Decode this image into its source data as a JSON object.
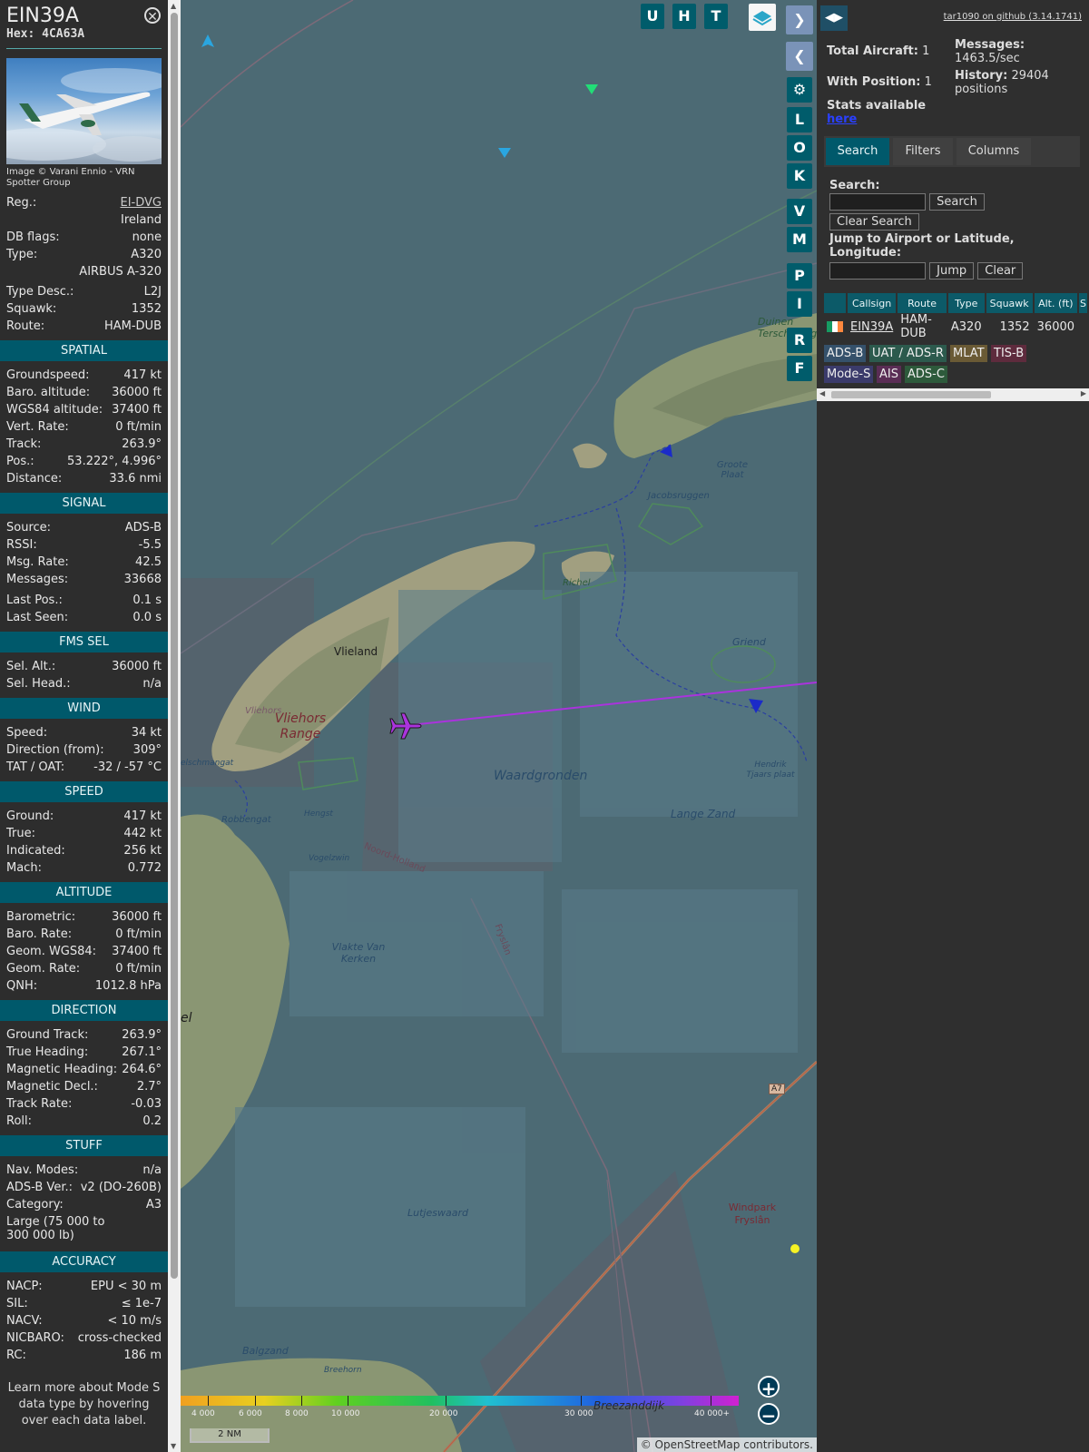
{
  "info": {
    "callsign": "EIN39A",
    "hex_label": "Hex:",
    "hex": "4CA63A",
    "photo_credit": "Image © Varani Ennio - VRN Spotter Group",
    "registration": {
      "label": "Reg.:",
      "value": "EI-DVG",
      "country": "Ireland"
    },
    "rows_top": [
      {
        "label": "DB flags:",
        "value": "none"
      },
      {
        "label": "Type:",
        "value": "A320"
      }
    ],
    "type_name": "AIRBUS A-320",
    "rows_mid": [
      {
        "label": "Type Desc.:",
        "value": "L2J"
      },
      {
        "label": "Squawk:",
        "value": "1352"
      },
      {
        "label": "Route:",
        "value": "HAM-DUB"
      }
    ],
    "spatial": {
      "title": "SPATIAL",
      "rows": [
        {
          "label": "Groundspeed:",
          "value": "417 kt"
        },
        {
          "label": "Baro. altitude:",
          "value": "36000 ft"
        },
        {
          "label": "WGS84 altitude:",
          "value": "37400 ft"
        },
        {
          "label": "Vert. Rate:",
          "value": "0 ft/min"
        },
        {
          "label": "Track:",
          "value": "263.9°"
        },
        {
          "label": "Pos.:",
          "value": "53.222°, 4.996°"
        },
        {
          "label": "Distance:",
          "value": "33.6 nmi"
        }
      ]
    },
    "signal": {
      "title": "SIGNAL",
      "rows": [
        {
          "label": "Source:",
          "value": "ADS-B"
        },
        {
          "label": "RSSI:",
          "value": "-5.5"
        },
        {
          "label": "Msg. Rate:",
          "value": "42.5"
        },
        {
          "label": "Messages:",
          "value": "33668"
        }
      ],
      "rows2": [
        {
          "label": "Last Pos.:",
          "value": "0.1 s"
        },
        {
          "label": "Last Seen:",
          "value": "0.0 s"
        }
      ]
    },
    "fms": {
      "title": "FMS SEL",
      "rows": [
        {
          "label": "Sel. Alt.:",
          "value": "36000 ft"
        },
        {
          "label": "Sel. Head.:",
          "value": "n/a"
        }
      ]
    },
    "wind": {
      "title": "WIND",
      "rows": [
        {
          "label": "Speed:",
          "value": "34 kt"
        },
        {
          "label": "Direction (from):",
          "value": "309°"
        },
        {
          "label": "TAT / OAT:",
          "value": "-32 / -57 °C"
        }
      ]
    },
    "speed": {
      "title": "SPEED",
      "rows": [
        {
          "label": "Ground:",
          "value": "417 kt"
        },
        {
          "label": "True:",
          "value": "442 kt"
        },
        {
          "label": "Indicated:",
          "value": "256 kt"
        },
        {
          "label": "Mach:",
          "value": "0.772"
        }
      ]
    },
    "altitude": {
      "title": "ALTITUDE",
      "rows": [
        {
          "label": "Barometric:",
          "value": "36000 ft"
        },
        {
          "label": "Baro. Rate:",
          "value": "0 ft/min"
        },
        {
          "label": "Geom. WGS84:",
          "value": "37400 ft"
        },
        {
          "label": "Geom. Rate:",
          "value": "0 ft/min"
        },
        {
          "label": "QNH:",
          "value": "1012.8 hPa"
        }
      ]
    },
    "direction": {
      "title": "DIRECTION",
      "rows": [
        {
          "label": "Ground Track:",
          "value": "263.9°"
        },
        {
          "label": "True Heading:",
          "value": "267.1°"
        },
        {
          "label": "Magnetic Heading:",
          "value": "264.6°"
        },
        {
          "label": "Magnetic Decl.:",
          "value": "2.7°"
        },
        {
          "label": "Track Rate:",
          "value": "-0.03"
        },
        {
          "label": "Roll:",
          "value": "0.2"
        }
      ]
    },
    "stuff": {
      "title": "STUFF",
      "rows": [
        {
          "label": "Nav. Modes:",
          "value": "n/a"
        },
        {
          "label": "ADS-B Ver.:",
          "value": "v2 (DO-260B)"
        },
        {
          "label": "Category:",
          "value": "A3"
        }
      ],
      "category_desc": "Large (75 000 to 300 000 lb)"
    },
    "accuracy": {
      "title": "ACCURACY",
      "rows": [
        {
          "label": "NACP:",
          "value": "EPU < 30 m"
        },
        {
          "label": "SIL:",
          "value": "≤ 1e-7"
        },
        {
          "label": "NACV:",
          "value": "< 10 m/s"
        },
        {
          "label": "NICBARO:",
          "value": "cross-checked"
        },
        {
          "label": "RC:",
          "value": "186 m"
        }
      ]
    },
    "learn_more": "Learn more about Mode S data type by hovering over each data label."
  },
  "map": {
    "top_buttons": [
      "U",
      "H",
      "T"
    ],
    "side_buttons": [
      "L",
      "O",
      "K",
      "V",
      "M",
      "P",
      "I",
      "R",
      "F"
    ],
    "labels": {
      "vlieland": "Vlieland",
      "vliehors": "Vliehors",
      "vliehors_range": "Vliehors Range",
      "waardgronden": "Waardgronden",
      "richel": "Richel",
      "jacobsruggen": "Jacobsruggen",
      "groote_plaat": "Groote Plaat",
      "duinen_terschelling": "Duinen Terschelling",
      "griend": "Griend",
      "lange_zand": "Lange Zand",
      "hendrik_tjaars_plaat": "Hendrik Tjaars plaat",
      "noord_holland": "Noord-Holland",
      "fryslan": "Fryslân",
      "vlakte_van_kerken": "Vlakte Van Kerken",
      "lutjeswaard": "Lutjeswaard",
      "balgzand": "Balgzand",
      "breehorn": "Breehorn",
      "windpark_fryslan": "Windpark Fryslân",
      "robbengat": "Robbengat",
      "hengst": "Hengst",
      "vogelzwin": "Vogelzwin",
      "helschmangat": "elschmangat",
      "el": "el",
      "a7": "A7",
      "breezanddijk": "Breezanddijk"
    },
    "altitude_scale": [
      "4 000",
      "6 000",
      "8 000",
      "10 000",
      "20 000",
      "30 000",
      "40 000+"
    ],
    "scale_bar": "2 NM",
    "attribution": "© OpenStreetMap contributors.",
    "zoom_in": "+",
    "zoom_out": "−",
    "colors": {
      "selected_aircraft": "#aa33dd",
      "water": "#4a6570",
      "land": "#9c9a80"
    }
  },
  "sidebar": {
    "github_link": "tar1090 on github (3.14.1741)",
    "total_aircraft_label": "Total Aircraft:",
    "total_aircraft": "1",
    "with_position_label": "With Position:",
    "with_position": "1",
    "messages_label": "Messages:",
    "messages_rate": "1463.5/sec",
    "history_label": "History:",
    "history_value": "29404 positions",
    "stats_available": "Stats available",
    "stats_link": "here",
    "tabs": [
      "Search",
      "Filters",
      "Columns"
    ],
    "search_label": "Search:",
    "search_button": "Search",
    "clear_search_button": "Clear Search",
    "jump_label": "Jump to Airport or Latitude, Longitude:",
    "jump_button": "Jump",
    "clear_button": "Clear",
    "table": {
      "headers": [
        "",
        "Callsign",
        "Route",
        "Type",
        "Squawk",
        "Alt. (ft)",
        "S"
      ],
      "rows": [
        [
          "",
          "EIN39A",
          "HAM-DUB",
          "A320",
          "1352",
          "36000"
        ]
      ]
    },
    "legend": [
      {
        "label": "ADS-B",
        "color": "#35516b"
      },
      {
        "label": "UAT / ADS-R",
        "color": "#2c5a4d"
      },
      {
        "label": "MLAT",
        "color": "#6a5a35"
      },
      {
        "label": "TIS-B",
        "color": "#5e2b3d"
      },
      {
        "label": "Mode-S",
        "color": "#3b3b6b"
      },
      {
        "label": "AIS",
        "color": "#5a2d55"
      },
      {
        "label": "ADS-C",
        "color": "#2d5a3b"
      }
    ]
  }
}
